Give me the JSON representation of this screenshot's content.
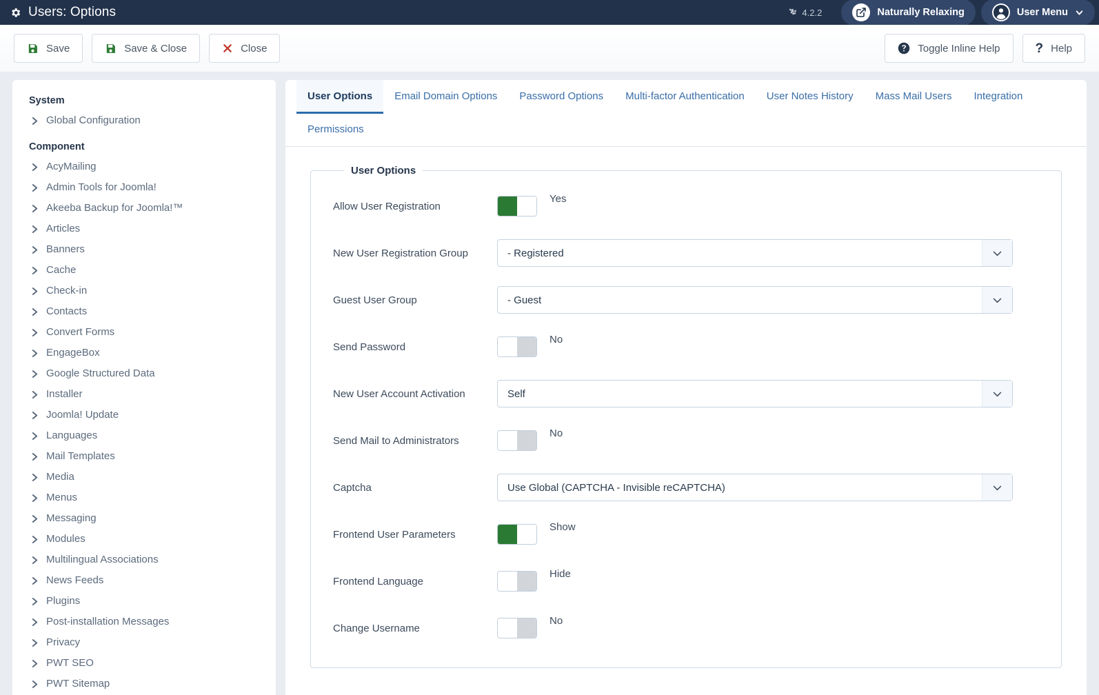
{
  "header": {
    "title": "Users: Options",
    "gear_icon": "gear-icon",
    "version": "4.2.2",
    "version_icon": "joomla-logo-icon",
    "site_pill": {
      "label": "Naturally Relaxing",
      "icon": "external-link-icon"
    },
    "user_pill": {
      "label": "User Menu",
      "icon": "user-circle-icon",
      "chevron": "chevron-down-icon"
    }
  },
  "toolbar": {
    "left": [
      {
        "label": "Save",
        "icon": "save-disk-icon",
        "name": "save-button"
      },
      {
        "label": "Save & Close",
        "icon": "save-disk-icon",
        "name": "save-close-button"
      },
      {
        "label": "Close",
        "icon": "close-x-icon",
        "name": "close-button"
      }
    ],
    "right": [
      {
        "label": "Toggle Inline Help",
        "icon": "help-circle-icon",
        "name": "toggle-inline-help-button"
      },
      {
        "label": "Help",
        "icon": "question-mark-icon",
        "name": "help-button"
      }
    ]
  },
  "sidebar": {
    "groups": [
      {
        "title": "System",
        "items": [
          {
            "label": "Global Configuration"
          }
        ]
      },
      {
        "title": "Component",
        "items": [
          {
            "label": "AcyMailing"
          },
          {
            "label": "Admin Tools for Joomla!"
          },
          {
            "label": "Akeeba Backup for Joomla!™"
          },
          {
            "label": "Articles"
          },
          {
            "label": "Banners"
          },
          {
            "label": "Cache"
          },
          {
            "label": "Check-in"
          },
          {
            "label": "Contacts"
          },
          {
            "label": "Convert Forms"
          },
          {
            "label": "EngageBox"
          },
          {
            "label": "Google Structured Data"
          },
          {
            "label": "Installer"
          },
          {
            "label": "Joomla! Update"
          },
          {
            "label": "Languages"
          },
          {
            "label": "Mail Templates"
          },
          {
            "label": "Media"
          },
          {
            "label": "Menus"
          },
          {
            "label": "Messaging"
          },
          {
            "label": "Modules"
          },
          {
            "label": "Multilingual Associations"
          },
          {
            "label": "News Feeds"
          },
          {
            "label": "Plugins"
          },
          {
            "label": "Post-installation Messages"
          },
          {
            "label": "Privacy"
          },
          {
            "label": "PWT SEO"
          },
          {
            "label": "PWT Sitemap"
          }
        ]
      }
    ]
  },
  "tabs": [
    {
      "label": "User Options",
      "active": true
    },
    {
      "label": "Email Domain Options",
      "active": false
    },
    {
      "label": "Password Options",
      "active": false
    },
    {
      "label": "Multi-factor Authentication",
      "active": false
    },
    {
      "label": "User Notes History",
      "active": false
    },
    {
      "label": "Mass Mail Users",
      "active": false
    },
    {
      "label": "Integration",
      "active": false
    },
    {
      "label": "Permissions",
      "active": false
    }
  ],
  "panel": {
    "legend": "User Options",
    "fields": [
      {
        "label": "Allow User Registration",
        "type": "switch",
        "state": "on",
        "value": "Yes"
      },
      {
        "label": "New User Registration Group",
        "type": "select",
        "value": "- Registered"
      },
      {
        "label": "Guest User Group",
        "type": "select",
        "value": "- Guest"
      },
      {
        "label": "Send Password",
        "type": "switch",
        "state": "off",
        "value": "No"
      },
      {
        "label": "New User Account Activation",
        "type": "select",
        "value": "Self"
      },
      {
        "label": "Send Mail to Administrators",
        "type": "switch",
        "state": "off",
        "value": "No"
      },
      {
        "label": "Captcha",
        "type": "select",
        "value": "Use Global (CAPTCHA - Invisible reCAPTCHA)"
      },
      {
        "label": "Frontend User Parameters",
        "type": "switch",
        "state": "on",
        "value": "Show"
      },
      {
        "label": "Frontend Language",
        "type": "switch",
        "state": "off",
        "value": "Hide"
      },
      {
        "label": "Change Username",
        "type": "switch",
        "state": "off",
        "value": "No"
      }
    ]
  },
  "colors": {
    "header_bg": "#22324b",
    "accent": "#2b6cb0",
    "switch_on": "#2b7a33",
    "danger": "#c0392b",
    "save_green": "#2b7a33"
  }
}
